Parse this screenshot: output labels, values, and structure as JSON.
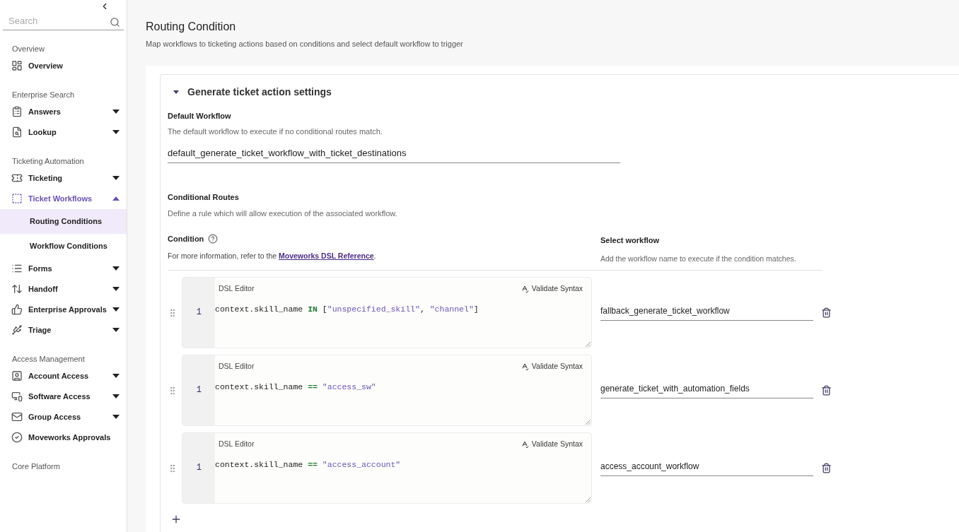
{
  "sidebar": {
    "search": {
      "placeholder": "Search"
    },
    "sections": [
      {
        "title": "Overview",
        "items": [
          {
            "label": "Overview",
            "selected": false
          }
        ]
      },
      {
        "title": "Enterprise Search",
        "items": [
          {
            "label": "Answers",
            "expanded": false,
            "selected": false
          },
          {
            "label": "Lookup",
            "expanded": false,
            "selected": false
          }
        ]
      },
      {
        "title": "Ticketing Automation",
        "items": [
          {
            "label": "Ticketing",
            "expanded": false,
            "selected": false
          },
          {
            "label": "Ticket Workflows",
            "expanded": true,
            "selected": true,
            "children": [
              {
                "label": "Routing Conditions",
                "selected": true
              },
              {
                "label": "Workflow Conditions",
                "selected": false
              }
            ]
          },
          {
            "label": "Forms",
            "expanded": false,
            "selected": false
          },
          {
            "label": "Handoff",
            "expanded": false,
            "selected": false
          },
          {
            "label": "Enterprise Approvals",
            "expanded": false,
            "selected": false
          },
          {
            "label": "Triage",
            "expanded": false,
            "selected": false
          }
        ]
      },
      {
        "title": "Access Management",
        "items": [
          {
            "label": "Account Access",
            "expanded": false,
            "selected": false
          },
          {
            "label": "Software Access",
            "expanded": false,
            "selected": false
          },
          {
            "label": "Group Access",
            "expanded": false,
            "selected": false
          },
          {
            "label": "Moveworks Approvals",
            "selected": false
          }
        ]
      },
      {
        "title": "Core Platform"
      }
    ]
  },
  "page": {
    "title": "Routing Condition",
    "subtitle": "Map workflows to ticketing actions based on conditions and select default workflow to trigger"
  },
  "panel": {
    "title": "Generate ticket action settings",
    "expanded": true,
    "default_workflow": {
      "label": "Default Workflow",
      "help": "The default workflow to execute if no conditional routes match.",
      "value": "default_generate_ticket_workflow_with_ticket_destinations"
    },
    "conditional_routes": {
      "label": "Conditional Routes",
      "help": "Define a rule which will allow execution of the associated workflow.",
      "condition_header": {
        "label": "Condition",
        "help_before": "For more information, refer to the ",
        "link": "Moveworks DSL Reference",
        "help_after": "."
      },
      "workflow_header": {
        "label": "Select workflow",
        "help": "Add the workflow name to execute if the condition matches."
      },
      "routes": [
        {
          "editor_label": "DSL Editor",
          "validate": "Validate Syntax",
          "line_number": "1",
          "code": [
            {
              "kind": "plain",
              "text": "context.skill_name "
            },
            {
              "kind": "keyword",
              "text": "IN"
            },
            {
              "kind": "plain",
              "text": " ["
            },
            {
              "kind": "string",
              "text": "\"unspecified_skill\""
            },
            {
              "kind": "plain",
              "text": ", "
            },
            {
              "kind": "string",
              "text": "\"channel\""
            },
            {
              "kind": "plain",
              "text": "]"
            }
          ],
          "workflow": "fallback_generate_ticket_workflow"
        },
        {
          "editor_label": "DSL Editor",
          "validate": "Validate Syntax",
          "line_number": "1",
          "code": [
            {
              "kind": "plain",
              "text": "context.skill_name "
            },
            {
              "kind": "keyword",
              "text": "== "
            },
            {
              "kind": "string",
              "text": "\"access_sw\""
            }
          ],
          "workflow": "generate_ticket_with_automation_fields"
        },
        {
          "editor_label": "DSL Editor",
          "validate": "Validate Syntax",
          "line_number": "1",
          "code": [
            {
              "kind": "plain",
              "text": "context.skill_name "
            },
            {
              "kind": "keyword",
              "text": "== "
            },
            {
              "kind": "string",
              "text": "\"access_account\""
            }
          ],
          "workflow": "access_account_workflow"
        }
      ]
    }
  }
}
